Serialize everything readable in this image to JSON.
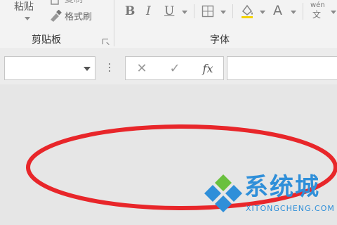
{
  "ribbon": {
    "clipboard": {
      "label": "剪贴板",
      "paste_label": "粘贴",
      "copy_label": "复制",
      "format_painter_label": "格式刷",
      "launcher_icon": "dialog-launcher-icon"
    },
    "font": {
      "label": "字体",
      "bold": "B",
      "italic": "I",
      "underline": "U",
      "font_color": "A",
      "phonetic_top": "wén",
      "phonetic_bottom": "文"
    }
  },
  "formula_bar": {
    "name_box_value": "",
    "cancel_icon": "✕",
    "enter_icon": "✓",
    "fx_label": "fx",
    "formula_value": ""
  },
  "annotation": {
    "shape": "ellipse",
    "color": "#e8262a"
  },
  "watermark": {
    "text": "系统城",
    "subtext": "XITONGCHENG.COM",
    "colors": {
      "blue": "#2f8fd9",
      "green": "#6ac03e"
    }
  }
}
